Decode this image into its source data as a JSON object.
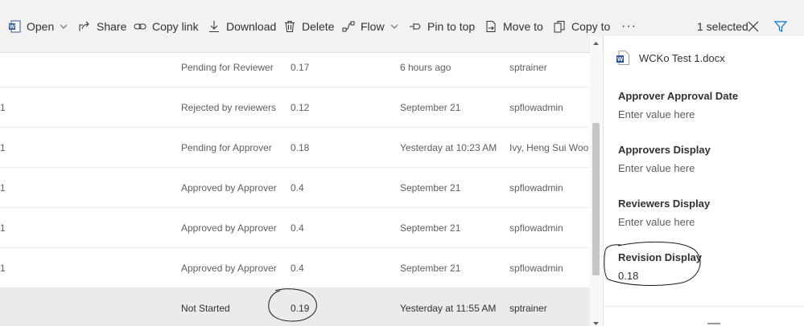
{
  "toolbar": {
    "open": "Open",
    "share": "Share",
    "copy_link": "Copy link",
    "download": "Download",
    "delete": "Delete",
    "flow": "Flow",
    "pin_to_top": "Pin to top",
    "move_to": "Move to",
    "copy_to": "Copy to",
    "more": "···",
    "selected_count": "1 selected"
  },
  "rows": [
    {
      "idx": "",
      "status": "Pending for Reviewer",
      "revision": "0.17",
      "modified": "6 hours ago",
      "modified_by": "sptrainer"
    },
    {
      "idx": "1",
      "status": "Rejected by reviewers",
      "revision": "0.12",
      "modified": "September 21",
      "modified_by": "spflowadmin"
    },
    {
      "idx": "1",
      "status": "Pending for Approver",
      "revision": "0.18",
      "modified": "Yesterday at 10:23 AM",
      "modified_by": "Ivy, Heng Sui Wooi"
    },
    {
      "idx": "1",
      "status": "Approved by Approver",
      "revision": "0.4",
      "modified": "September 21",
      "modified_by": "spflowadmin"
    },
    {
      "idx": "1",
      "status": "Approved by Approver",
      "revision": "0.4",
      "modified": "September 21",
      "modified_by": "spflowadmin"
    },
    {
      "idx": "1",
      "status": "Approved by Approver",
      "revision": "0.4",
      "modified": "September 21",
      "modified_by": "spflowadmin"
    },
    {
      "idx": "",
      "status": "Not Started",
      "revision": "0.19",
      "modified": "Yesterday at 11:55 AM",
      "modified_by": "sptrainer"
    }
  ],
  "details": {
    "file_name": "WCKo Test 1.docx",
    "fields": [
      {
        "label": "Approver Approval Date",
        "value": "Enter value here"
      },
      {
        "label": "Approvers Display",
        "value": "Enter value here"
      },
      {
        "label": "Reviewers Display",
        "value": "Enter value here"
      },
      {
        "label": "Revision Display",
        "value": "0.18"
      }
    ]
  },
  "colors": {
    "toolbar_bg": "#f3f2f1",
    "word_blue": "#2b579a",
    "selected_row": "#edebe9",
    "text": "#323130",
    "muted_text": "#605e5c"
  }
}
